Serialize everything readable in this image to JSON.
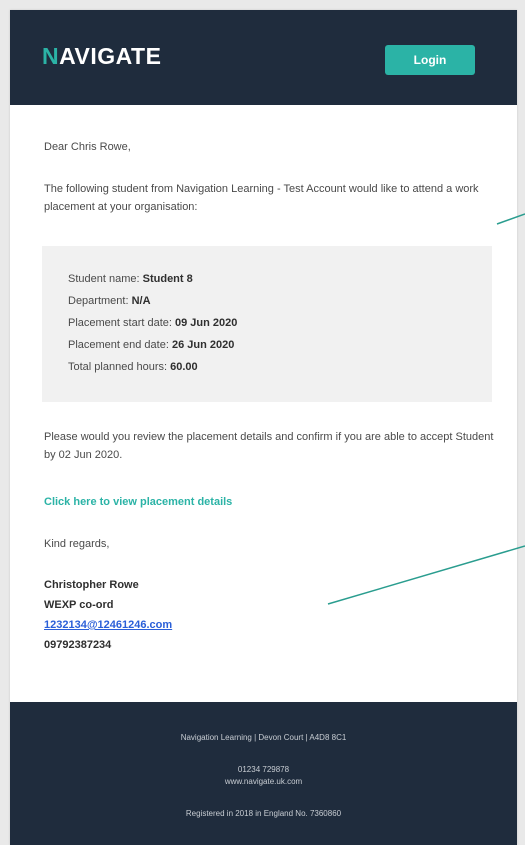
{
  "header": {
    "logo_first": "N",
    "logo_rest": "AVIGATE",
    "login_label": "Login"
  },
  "body": {
    "greeting": "Dear Chris Rowe,",
    "intro": "The following student from Navigation Learning - Test Account would like to attend a work placement at your organisation:",
    "details": [
      {
        "label": "Student name:",
        "value": "Student 8"
      },
      {
        "label": "Department:",
        "value": "N/A"
      },
      {
        "label": "Placement start date:",
        "value": "09 Jun 2020"
      },
      {
        "label": "Placement end date:",
        "value": "26 Jun 2020"
      },
      {
        "label": "Total planned hours:",
        "value": "60.00"
      }
    ],
    "review": "Please would you review the placement details and confirm if you are able to accept Student by 02 Jun 2020.",
    "view_link": "Click here to view placement details",
    "regards": "Kind regards,",
    "signature": {
      "name": "Christopher Rowe",
      "role": "WEXP co-ord",
      "email": "1232134@12461246.com",
      "phone": "09792387234"
    }
  },
  "footer": {
    "line1": "Navigation Learning | Devon Court | A4D8 8C1",
    "line2": "01234 729878",
    "line3": "www.navigate.uk.com",
    "line4": "Registered in 2018 in England No. 7360860"
  },
  "colors": {
    "header_bg": "#1f2c3d",
    "accent": "#2bb3a6",
    "link_blue": "#2a5fd8"
  }
}
